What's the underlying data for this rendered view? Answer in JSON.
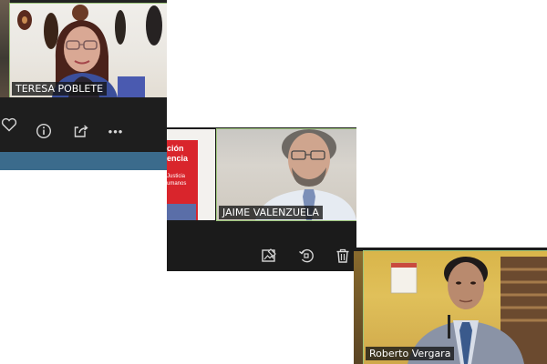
{
  "windows": [
    {
      "participant": {
        "name": "TERESA POBLETE"
      },
      "toolbar": {
        "icons": [
          "heart-icon",
          "info-icon",
          "share-icon",
          "more-icon"
        ],
        "more_label": "•••"
      },
      "accent_color": "#3b6b8c"
    },
    {
      "book": {
        "title_lines": [
          "ción",
          "encia"
        ],
        "subtitle_lines": [
          "Justicia",
          "umanos"
        ]
      },
      "participant": {
        "name": "JAIME VALENZUELA"
      },
      "toolbar": {
        "icons": [
          "edit-image-icon",
          "rotate-icon",
          "delete-icon"
        ]
      }
    },
    {
      "participant": {
        "name": "Roberto Vergara"
      }
    }
  ],
  "colors": {
    "active_speaker_border": "#9cc47a",
    "toolbar_bg": "#1e1e1e",
    "book_red": "#d9252c"
  }
}
